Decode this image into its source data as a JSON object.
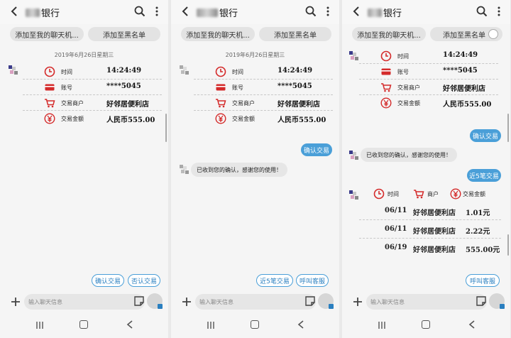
{
  "panels": [
    {
      "title": "银行",
      "chips": [
        "添加至我的聊天机...",
        "添加至黑名单"
      ],
      "date": "2019年6月26日星期三",
      "card": [
        {
          "label": "时间",
          "value": "14:24:49",
          "icon": "clock-icon"
        },
        {
          "label": "账号",
          "value": "****5045",
          "icon": "card-icon"
        },
        {
          "label": "交易商户",
          "value": "好邻居便利店",
          "icon": "cart-icon"
        },
        {
          "label": "交易金额",
          "value": "人民币555.00",
          "icon": "yuan-icon"
        }
      ],
      "quick_replies": [
        "确认交易",
        "否认交易"
      ],
      "input_placeholder": "输入聊天信息"
    },
    {
      "title": "银行",
      "chips": [
        "添加至我的聊天机...",
        "添加至黑名单"
      ],
      "date": "2019年6月26日星期三",
      "card": [
        {
          "label": "时间",
          "value": "14:24:49",
          "icon": "clock-icon"
        },
        {
          "label": "账号",
          "value": "****5045",
          "icon": "card-icon"
        },
        {
          "label": "交易商户",
          "value": "好邻居便利店",
          "icon": "cart-icon"
        },
        {
          "label": "交易金额",
          "value": "人民币555.00",
          "icon": "yuan-icon"
        }
      ],
      "sent": "确认交易",
      "received": "已收到您的确认，感谢您的使用！",
      "quick_replies": [
        "近5笔交易",
        "呼叫客服"
      ],
      "input_placeholder": "输入聊天信息"
    },
    {
      "title": "银行",
      "chips": [
        "添加至我的聊天机...",
        "添加至黑名单"
      ],
      "card": [
        {
          "label": "时间",
          "value": "14:24:49",
          "icon": "clock-icon"
        },
        {
          "label": "账号",
          "value": "****5045",
          "icon": "card-icon"
        },
        {
          "label": "交易商户",
          "value": "好邻居便利店",
          "icon": "cart-icon"
        },
        {
          "label": "交易金额",
          "value": "人民币555.00",
          "icon": "yuan-icon"
        }
      ],
      "sent1": "确认交易",
      "received": "已收到您的确认，感谢您的使用！",
      "sent2": "近5笔交易",
      "txn_headers": [
        "时间",
        "商户",
        "交易金额"
      ],
      "txn_rows": [
        [
          "06/11",
          "好邻居便利店",
          "1.01元"
        ],
        [
          "06/11",
          "好邻居便利店",
          "2.22元"
        ],
        [
          "06/19",
          "好邻居便利店",
          "555.00元"
        ]
      ],
      "quick_replies": [
        "呼叫客服"
      ],
      "input_placeholder": "输入聊天信息"
    }
  ],
  "colors": {
    "accent": "#4a9fd8",
    "icon_red": "#d42a2a"
  }
}
